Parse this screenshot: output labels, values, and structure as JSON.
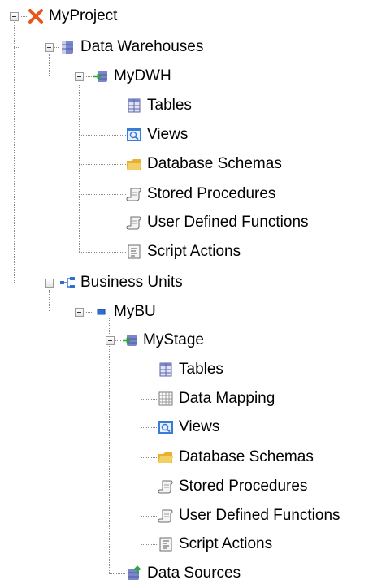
{
  "tree": {
    "root": {
      "label": "MyProject",
      "icon": "project-x-icon",
      "children": {
        "data_warehouses": {
          "label": "Data Warehouses",
          "icon": "database-icon",
          "children": {
            "mydwh": {
              "label": "MyDWH",
              "icon": "stage-database-icon",
              "items": [
                {
                  "label": "Tables",
                  "icon": "table-icon"
                },
                {
                  "label": "Views",
                  "icon": "view-icon"
                },
                {
                  "label": "Database Schemas",
                  "icon": "folder-icon"
                },
                {
                  "label": "Stored Procedures",
                  "icon": "scroll-icon"
                },
                {
                  "label": "User Defined Functions",
                  "icon": "scroll-icon"
                },
                {
                  "label": "Script Actions",
                  "icon": "script-icon"
                }
              ]
            }
          }
        },
        "business_units": {
          "label": "Business Units",
          "icon": "hierarchy-icon",
          "children": {
            "mybu": {
              "label": "MyBU",
              "icon": "business-unit-icon",
              "children": {
                "mystage": {
                  "label": "MyStage",
                  "icon": "stage-database-icon",
                  "items": [
                    {
                      "label": "Tables",
                      "icon": "table-icon"
                    },
                    {
                      "label": "Data Mapping",
                      "icon": "grid-icon"
                    },
                    {
                      "label": "Views",
                      "icon": "view-icon"
                    },
                    {
                      "label": "Database Schemas",
                      "icon": "folder-icon"
                    },
                    {
                      "label": "Stored Procedures",
                      "icon": "scroll-icon"
                    },
                    {
                      "label": "User Defined Functions",
                      "icon": "scroll-icon"
                    },
                    {
                      "label": "Script Actions",
                      "icon": "script-icon"
                    }
                  ]
                },
                "data_sources": {
                  "label": "Data Sources",
                  "icon": "data-source-icon"
                }
              }
            }
          }
        }
      }
    }
  },
  "colors": {
    "connector": "#8a8a8a",
    "project_x": "#e8561c",
    "folder": "#f3c64a",
    "database": "#7a86c8"
  }
}
